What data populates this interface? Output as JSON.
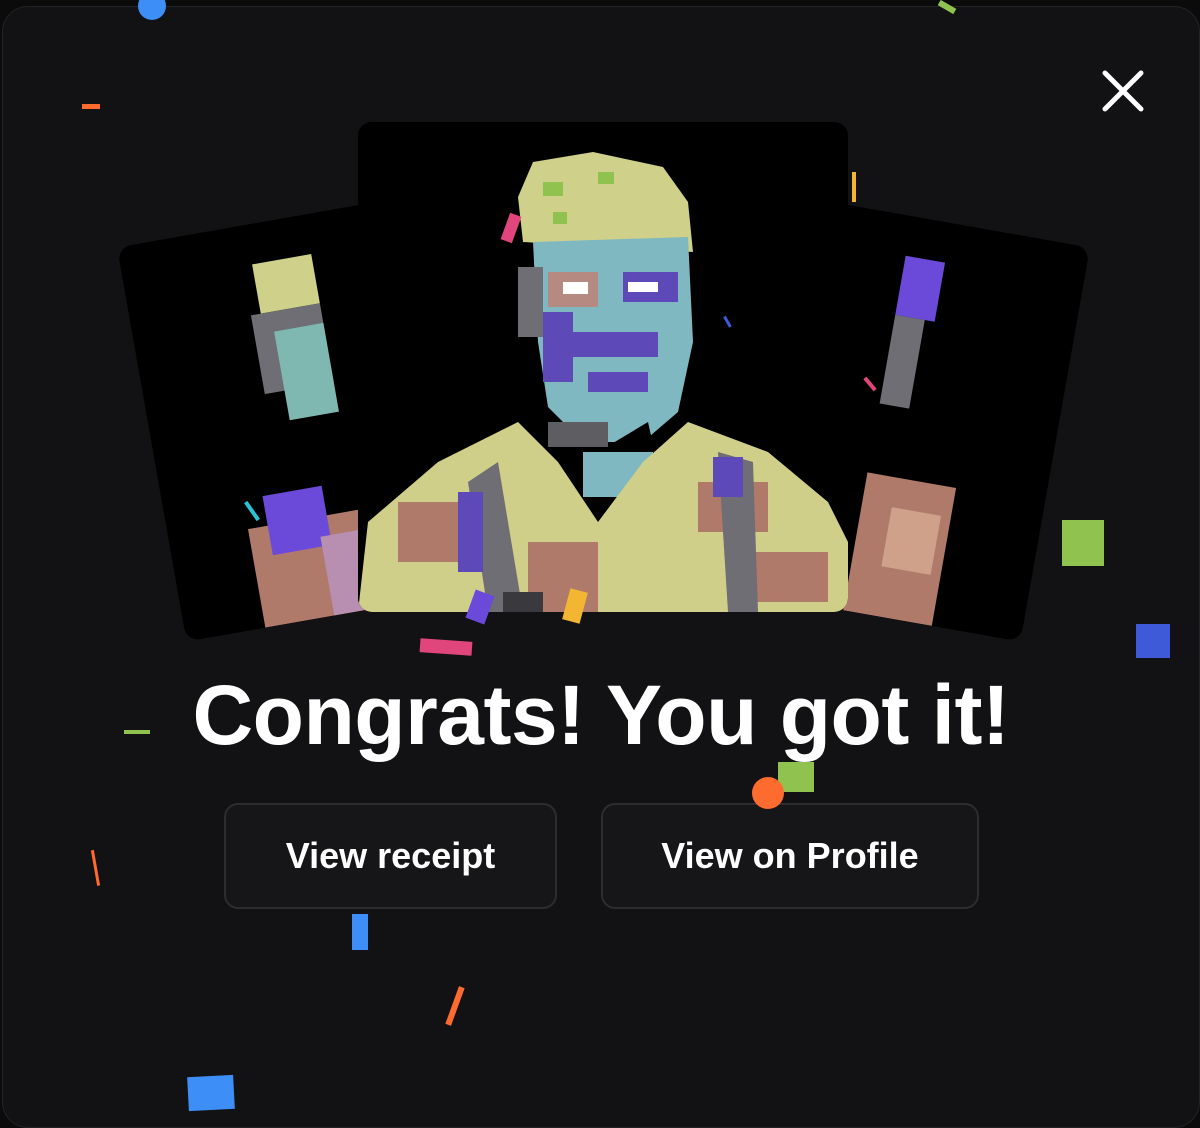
{
  "background_row": {
    "left_text": "",
    "right_text": ""
  },
  "modal": {
    "close_label": "Close",
    "title": "Congrats! You got it!",
    "buttons": {
      "receipt": "View receipt",
      "profile": "View on Profile"
    }
  },
  "colors": {
    "modal_bg": "#121214",
    "button_bg": "#161618",
    "button_border": "#2c2c31",
    "title_text": "#ffffff",
    "confetti": [
      "#ff6a2e",
      "#3e8ef7",
      "#8fc24f",
      "#e0457b",
      "#6b4ad9",
      "#f2b632",
      "#2cc3d6"
    ]
  },
  "icons": {
    "close": "close-icon",
    "artwork": "pixel-art-portrait"
  }
}
